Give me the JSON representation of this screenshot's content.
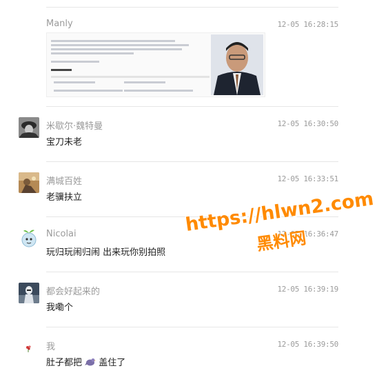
{
  "comments": [
    {
      "name": "Manly",
      "time": "12-05 16:28:15",
      "text": "",
      "avatar_icon": "none",
      "has_embed": true
    },
    {
      "name": "米歇尔·魏特曼",
      "time": "12-05 16:30:50",
      "text": "宝刀未老",
      "avatar_icon": "soldier-avatar-icon"
    },
    {
      "name": "满城百姓",
      "time": "12-05 16:33:51",
      "text": "老骥扶立",
      "avatar_icon": "painting-avatar-icon"
    },
    {
      "name": "Nicolai",
      "time": "12-05 16:36:47",
      "text": "玩归玩闹归闹 出来玩你别拍照",
      "avatar_icon": "cartoon-avatar-icon"
    },
    {
      "name": "都会好起来的",
      "time": "12-05 16:39:19",
      "text": "我嘞个",
      "avatar_icon": "trooper-avatar-icon"
    },
    {
      "name": "我",
      "time": "12-05 16:39:50",
      "text_before": "肚子都把",
      "emoji": "pigeon",
      "text_after": "盖住了",
      "avatar_icon": "flower-avatar-icon"
    }
  ],
  "watermark": {
    "url": "https://hlwn2.com",
    "name": "黑料网"
  },
  "colors": {
    "name": "#9b9b9b",
    "text": "#222222",
    "divider": "#e6e6e6",
    "watermark": "#ff8a00"
  }
}
